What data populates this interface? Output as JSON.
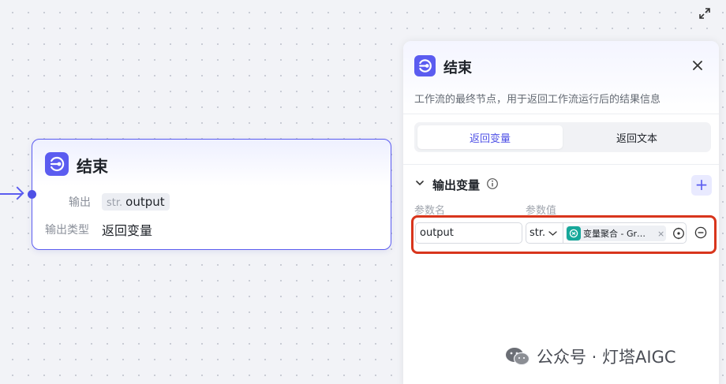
{
  "node": {
    "title": "结束",
    "output_label": "输出",
    "output_type": "str.",
    "output_var": "output",
    "output_kind_label": "输出类型",
    "output_kind_value": "返回变量"
  },
  "panel": {
    "title": "结束",
    "description": "工作流的最终节点，用于返回工作流运行后的结果信息",
    "tabs": [
      {
        "label": "返回变量",
        "active": true
      },
      {
        "label": "返回文本",
        "active": false
      }
    ],
    "section_title": "输出变量",
    "add_label": "+",
    "col_name": "参数名",
    "col_value": "参数值",
    "row": {
      "name": "output",
      "type": "str.",
      "ref_label": "变量聚合 - Gr…",
      "ref_remove": "×"
    }
  },
  "watermark": {
    "text": "公众号 · 灯塔AIGC"
  },
  "colors": {
    "accent": "#5b5cf0",
    "highlight": "#d8351c",
    "ref_icon": "#17a89a"
  },
  "icons": [
    "expand-icon",
    "end-node-icon",
    "close-icon",
    "chevron-down-icon",
    "info-icon",
    "add-icon",
    "variable-aggregate-icon",
    "target-icon",
    "minus-circle-icon",
    "wechat-icon"
  ]
}
